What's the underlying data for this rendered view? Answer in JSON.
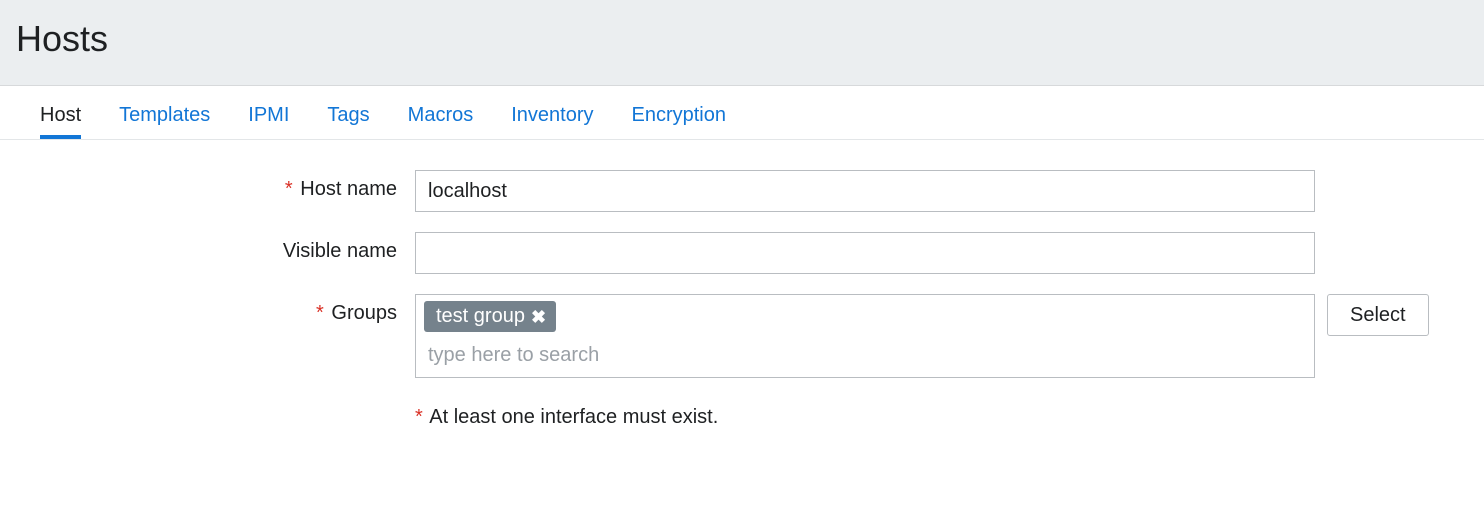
{
  "header": {
    "title": "Hosts"
  },
  "tabs": [
    {
      "label": "Host",
      "active": true
    },
    {
      "label": "Templates",
      "active": false
    },
    {
      "label": "IPMI",
      "active": false
    },
    {
      "label": "Tags",
      "active": false
    },
    {
      "label": "Macros",
      "active": false
    },
    {
      "label": "Inventory",
      "active": false
    },
    {
      "label": "Encryption",
      "active": false
    }
  ],
  "form": {
    "host_name": {
      "label": "Host name",
      "required": true,
      "value": "localhost"
    },
    "visible_name": {
      "label": "Visible name",
      "required": false,
      "value": ""
    },
    "groups": {
      "label": "Groups",
      "required": true,
      "tags": [
        {
          "label": "test group"
        }
      ],
      "placeholder": "type here to search",
      "select_button": "Select"
    },
    "interface_hint": "At least one interface must exist."
  },
  "required_marker": "*"
}
